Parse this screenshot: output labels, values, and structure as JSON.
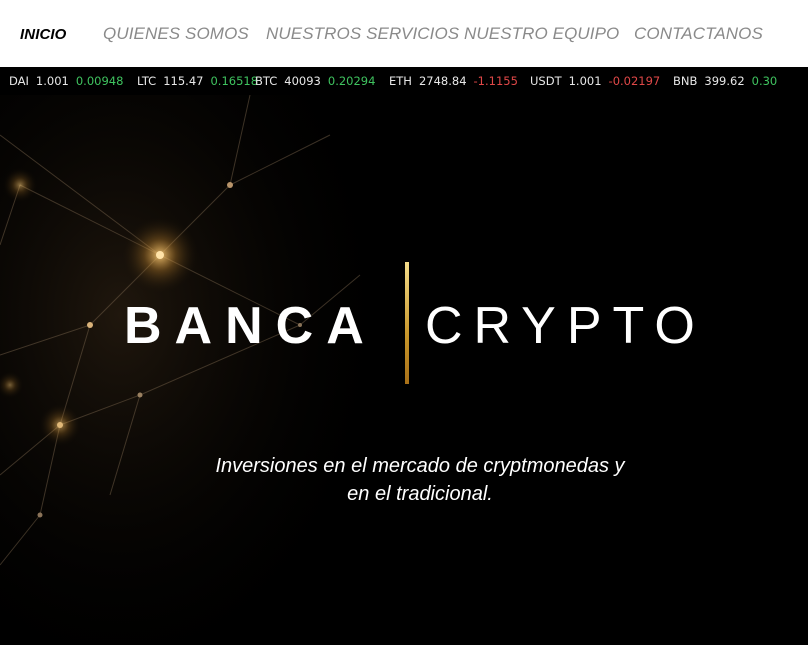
{
  "nav": {
    "items": [
      {
        "label": "INICIO"
      },
      {
        "label": "QUIENES SOMOS"
      },
      {
        "label": "NUESTROS SERVICIOS"
      },
      {
        "label": "NUESTRO EQUIPO"
      },
      {
        "label": "CONTACTANOS"
      }
    ]
  },
  "ticker": [
    {
      "symbol": "DAI",
      "price": "1.001",
      "change": "0.00948",
      "direction": "up"
    },
    {
      "symbol": "LTC",
      "price": "115.47",
      "change": "0.16518",
      "direction": "up"
    },
    {
      "symbol": "BTC",
      "price": "40093",
      "change": "0.20294",
      "direction": "up"
    },
    {
      "symbol": "ETH",
      "price": "2748.84",
      "change": "-1.1155",
      "direction": "down"
    },
    {
      "symbol": "USDT",
      "price": "1.001",
      "change": "-0.02197",
      "direction": "down"
    },
    {
      "symbol": "BNB",
      "price": "399.62",
      "change": "0.30",
      "direction": "up"
    }
  ],
  "hero": {
    "logo_left": "BANCA",
    "logo_right": "CRYPTO",
    "tagline_line1": "Inversiones en el mercado de cryptmonedas y",
    "tagline_line2": "en el tradicional."
  },
  "colors": {
    "up": "#3fc35f",
    "down": "#e04848",
    "gold": "#c8962a"
  }
}
